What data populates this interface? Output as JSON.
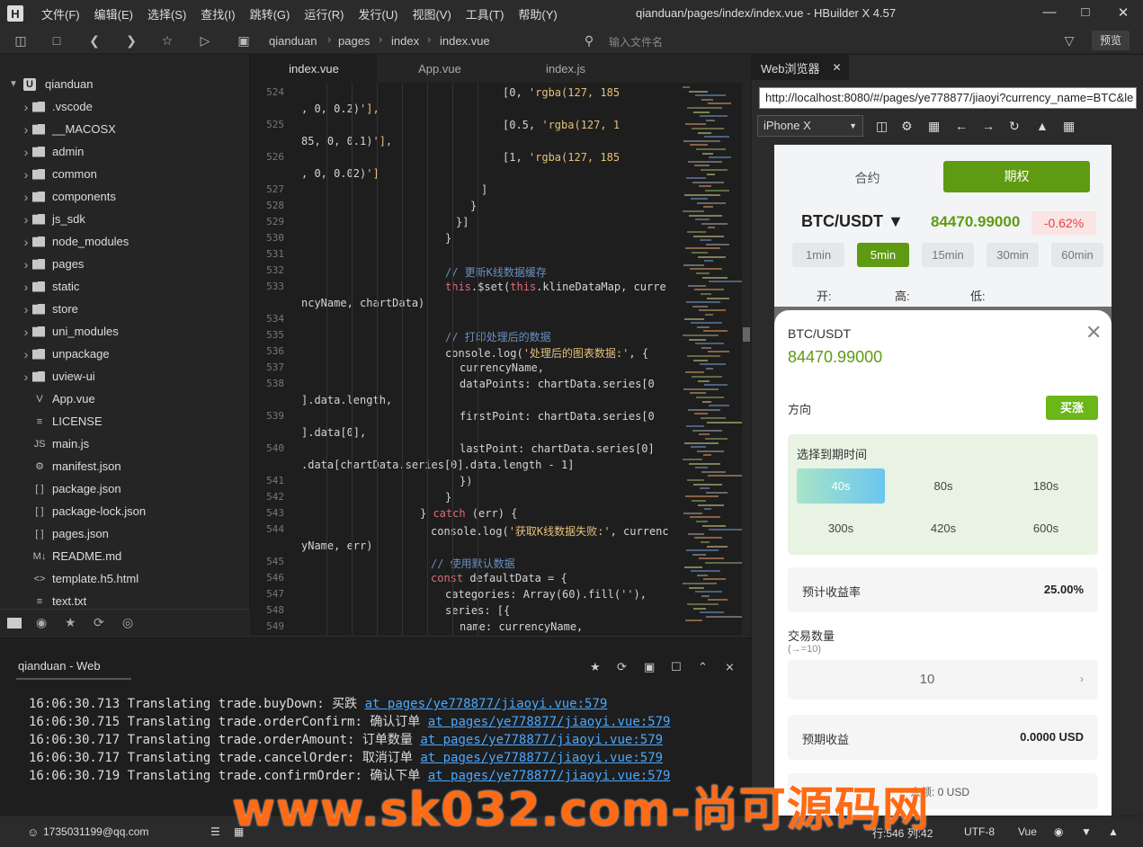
{
  "window": {
    "title": "qianduan/pages/index/index.vue - HBuilder X 4.57",
    "logo": "H"
  },
  "menu": [
    "文件(F)",
    "编辑(E)",
    "选择(S)",
    "查找(I)",
    "跳转(G)",
    "运行(R)",
    "发行(U)",
    "视图(V)",
    "工具(T)",
    "帮助(Y)"
  ],
  "breadcrumb": [
    "qianduan",
    "pages",
    "index",
    "index.vue"
  ],
  "toolbar": {
    "file_search_placeholder": "输入文件名",
    "preview_label": "预览"
  },
  "sidebar": {
    "root": "qianduan",
    "items": [
      {
        "label": ".vscode",
        "type": "folder"
      },
      {
        "label": "__MACOSX",
        "type": "folder"
      },
      {
        "label": "admin",
        "type": "folder"
      },
      {
        "label": "common",
        "type": "folder"
      },
      {
        "label": "components",
        "type": "folder"
      },
      {
        "label": "js_sdk",
        "type": "folder"
      },
      {
        "label": "node_modules",
        "type": "folder"
      },
      {
        "label": "pages",
        "type": "folder"
      },
      {
        "label": "static",
        "type": "folder"
      },
      {
        "label": "store",
        "type": "folder"
      },
      {
        "label": "uni_modules",
        "type": "folder"
      },
      {
        "label": "unpackage",
        "type": "folder"
      },
      {
        "label": "uview-ui",
        "type": "folder"
      },
      {
        "label": "App.vue",
        "type": "vue"
      },
      {
        "label": "LICENSE",
        "type": "file"
      },
      {
        "label": "main.js",
        "type": "js"
      },
      {
        "label": "manifest.json",
        "type": "manifest"
      },
      {
        "label": "package.json",
        "type": "json"
      },
      {
        "label": "package-lock.json",
        "type": "json"
      },
      {
        "label": "pages.json",
        "type": "json"
      },
      {
        "label": "README.md",
        "type": "md"
      },
      {
        "label": "template.h5.html",
        "type": "html"
      },
      {
        "label": "text.txt",
        "type": "file"
      }
    ]
  },
  "editor": {
    "tabs": [
      "index.vue",
      "App.vue",
      "index.js"
    ],
    "active_tab": "index.vue",
    "lines": [
      {
        "n": "524",
        "text": "[0, 'rgba(127, 185"
      },
      {
        "n": "",
        "text": ", 0, 0.2)'],"
      },
      {
        "n": "525",
        "text": "[0.5, 'rgba(127, 1"
      },
      {
        "n": "",
        "text": "85, 0, 0.1)'],"
      },
      {
        "n": "526",
        "text": "[1, 'rgba(127, 185"
      },
      {
        "n": "",
        "text": ", 0, 0.02)']"
      },
      {
        "n": "527",
        "text": "]"
      },
      {
        "n": "528",
        "text": "}"
      },
      {
        "n": "529",
        "text": "}]"
      },
      {
        "n": "530",
        "text": "}"
      },
      {
        "n": "531",
        "text": ""
      },
      {
        "n": "532",
        "text": "// 更新K线数据缓存"
      },
      {
        "n": "533",
        "text": "this.$set(this.klineDataMap, curre"
      },
      {
        "n": "",
        "text": "ncyName, chartData)"
      },
      {
        "n": "534",
        "text": ""
      },
      {
        "n": "535",
        "text": "// 打印处理后的数据"
      },
      {
        "n": "536",
        "text": "console.log('处理后的图表数据:', {"
      },
      {
        "n": "537",
        "text": "currencyName,"
      },
      {
        "n": "538",
        "text": "dataPoints: chartData.series[0"
      },
      {
        "n": "",
        "text": "].data.length,"
      },
      {
        "n": "539",
        "text": "firstPoint: chartData.series[0"
      },
      {
        "n": "",
        "text": "].data[0],"
      },
      {
        "n": "540",
        "text": "lastPoint: chartData.series[0]"
      },
      {
        "n": "",
        "text": ".data[chartData.series[0].data.length - 1]"
      },
      {
        "n": "541",
        "text": "})"
      },
      {
        "n": "542",
        "text": "}"
      },
      {
        "n": "543",
        "text": "} catch (err) {"
      },
      {
        "n": "544",
        "text": "console.log('获取K线数据失败:', currenc"
      },
      {
        "n": "",
        "text": "yName, err)"
      },
      {
        "n": "545",
        "text": "// 使用默认数据"
      },
      {
        "n": "546",
        "text": "const defaultData = {"
      },
      {
        "n": "547",
        "text": "categories: Array(60).fill(''),"
      },
      {
        "n": "548",
        "text": "series: [{"
      },
      {
        "n": "549",
        "text": "name: currencyName,"
      }
    ]
  },
  "console": {
    "tab": "qianduan - Web",
    "lines": [
      {
        "time": "16:06:30.713",
        "msg": "Translating trade.buyDown: 买跌",
        "link": "at pages/ye778877/jiaoyi.vue:579"
      },
      {
        "time": "16:06:30.715",
        "msg": "Translating trade.orderConfirm: 确认订单",
        "link": "at pages/ye778877/jiaoyi.vue:579"
      },
      {
        "time": "16:06:30.717",
        "msg": "Translating trade.orderAmount: 订单数量",
        "link": "at pages/ye778877/jiaoyi.vue:579"
      },
      {
        "time": "16:06:30.717",
        "msg": "Translating trade.cancelOrder: 取消订单",
        "link": "at pages/ye778877/jiaoyi.vue:579"
      },
      {
        "time": "16:06:30.719",
        "msg": "Translating trade.confirmOrder: 确认下单",
        "link": "at pages/ye778877/jiaoyi.vue:579"
      }
    ]
  },
  "browser": {
    "tab": "Web浏览器",
    "url": "http://localhost:8080/#/pages/ye778877/jiaoyi?currency_name=BTC&le",
    "device": "iPhone X",
    "app": {
      "segments": [
        "合约",
        "期权"
      ],
      "pair": "BTC/USDT ▼",
      "price": "84470.99000",
      "change": "-0.62%",
      "timeframes": [
        "1min",
        "5min",
        "15min",
        "30min",
        "60min"
      ],
      "active_timeframe": "5min",
      "ohl": [
        "开:",
        "高:",
        "低:"
      ],
      "sheet": {
        "title": "BTC/USDT",
        "price": "84470.99000",
        "direction_label": "方向",
        "direction_button": "买涨",
        "expiry_title": "选择到期时间",
        "expiry_options": [
          "40s",
          "80s",
          "180s",
          "300s",
          "420s",
          "600s"
        ],
        "active_expiry": "40s",
        "yield_label": "预计收益率",
        "yield_value": "25.00%",
        "qty_label": "交易数量",
        "qty_hint": "(→=10)",
        "qty_value": "10",
        "profit_label": "预期收益",
        "profit_value": "0.0000 USD",
        "balance": "余额: 0 USD"
      }
    }
  },
  "statusbar": {
    "user": "1735031199@qq.com",
    "cursor": "行:546  列:42",
    "encoding": "UTF-8",
    "language": "Vue"
  },
  "watermark": "www.sk032.com-尚可源码网",
  "colors": {
    "accent_green": "#5f9b12",
    "link_blue": "#4aa8ff",
    "watermark_orange": "#ff6a14",
    "down_red": "#e04545"
  }
}
